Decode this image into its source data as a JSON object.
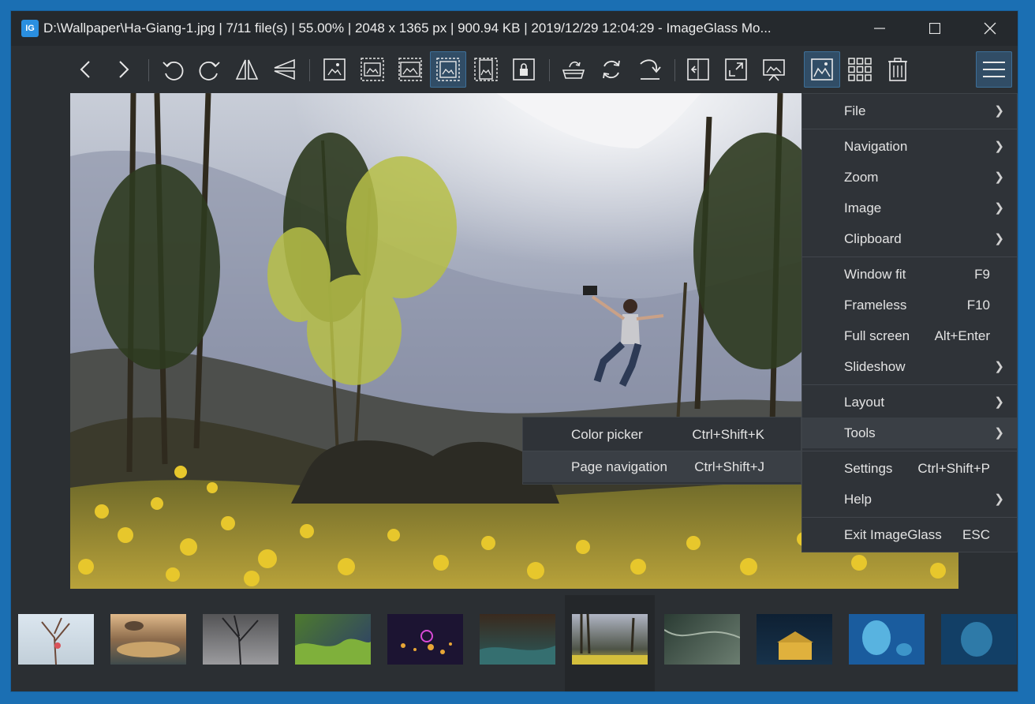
{
  "window": {
    "title": "D:\\Wallpaper\\Ha-Giang-1.jpg  |  7/11 file(s)  |  55.00%  |  2048 x 1365 px  |  900.94 KB  |  2019/12/29 12:04:29  - ImageGlass Mo...",
    "app_icon_text": "IG"
  },
  "toolbar": {
    "buttons": [
      "previous-image",
      "next-image",
      "rotate-left",
      "rotate-right",
      "flip-horizontal",
      "flip-vertical",
      "actual-size",
      "auto-zoom",
      "scale-to-width",
      "scale-to-fit",
      "scale-to-height",
      "lock-zoom",
      "open-with",
      "refresh",
      "go-to-image",
      "window-fit",
      "full-screen",
      "slideshow",
      "show-viewer",
      "thumbnail-bar",
      "delete",
      "main-menu"
    ],
    "active": [
      "scale-to-fit",
      "show-viewer",
      "main-menu"
    ]
  },
  "main_menu": {
    "items": [
      {
        "label": "File",
        "shortcut": "",
        "submenu": true
      },
      {
        "label": "Navigation",
        "shortcut": "",
        "submenu": true
      },
      {
        "label": "Zoom",
        "shortcut": "",
        "submenu": true
      },
      {
        "label": "Image",
        "shortcut": "",
        "submenu": true
      },
      {
        "label": "Clipboard",
        "shortcut": "",
        "submenu": true
      },
      {
        "label": "Window fit",
        "shortcut": "F9",
        "submenu": false
      },
      {
        "label": "Frameless",
        "shortcut": "F10",
        "submenu": false
      },
      {
        "label": "Full screen",
        "shortcut": "Alt+Enter",
        "submenu": false
      },
      {
        "label": "Slideshow",
        "shortcut": "",
        "submenu": true
      },
      {
        "label": "Layout",
        "shortcut": "",
        "submenu": true
      },
      {
        "label": "Tools",
        "shortcut": "",
        "submenu": true
      },
      {
        "label": "Settings",
        "shortcut": "Ctrl+Shift+P",
        "submenu": false
      },
      {
        "label": "Help",
        "shortcut": "",
        "submenu": true
      },
      {
        "label": "Exit ImageGlass",
        "shortcut": "ESC",
        "submenu": false
      }
    ],
    "highlighted": "Tools"
  },
  "tools_submenu": {
    "items": [
      {
        "label": "Color picker",
        "shortcut": "Ctrl+Shift+K"
      },
      {
        "label": "Page navigation",
        "shortcut": "Ctrl+Shift+J"
      }
    ]
  },
  "thumbnails": {
    "count": 11,
    "selected_index": 6
  },
  "colors": {
    "desktop": "#1b6fb3",
    "window_bg": "#2b2f33",
    "accent_active": "#314d66",
    "menu_bg": "#2f3338"
  }
}
